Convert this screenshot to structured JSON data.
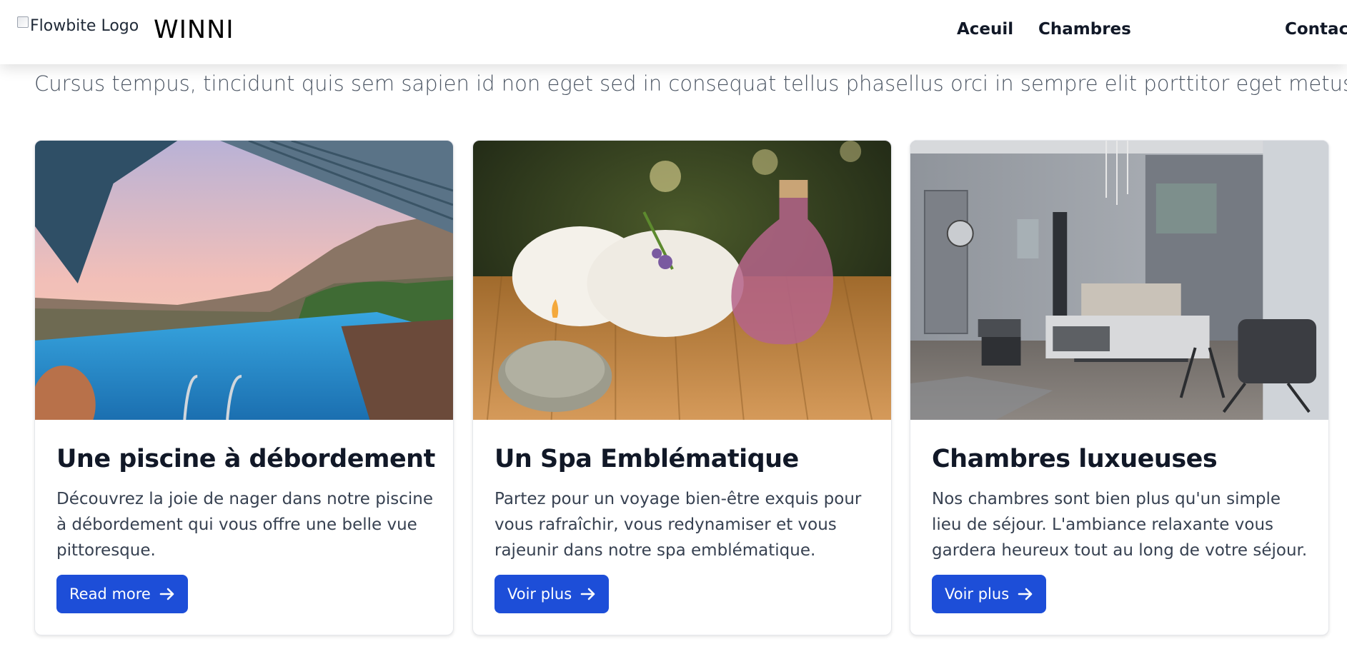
{
  "nav": {
    "logo_alt": "Flowbite Logo",
    "brand": "WINNI",
    "links": [
      "Aceuil",
      "Chambres",
      "Contact"
    ]
  },
  "hero": {
    "subtitle": "Cursus tempus, tincidunt quis sem sapien id non eget sed in consequat tellus phasellus orci in sempre elit porttitor eget metus."
  },
  "cards": [
    {
      "title": "Une piscine à débordement",
      "text": "Découvrez la joie de nager dans notre piscine à débordement qui vous offre une belle vue pittoresque.",
      "button": "Read more",
      "image": "infinity-pool-photo"
    },
    {
      "title": "Un Spa Emblématique",
      "text": "Partez pour un voyage bien-être exquis pour vous rafraîchir, vous redynamiser et vous rajeunir dans notre spa emblématique.",
      "button": "Voir plus",
      "image": "spa-towels-photo"
    },
    {
      "title": "Chambres luxueuses",
      "text": "Nos chambres sont bien plus qu'un simple lieu de séjour. L'ambiance relaxante vous gardera heureux tout au long de votre séjour.",
      "button": "Voir plus",
      "image": "luxury-bedroom-photo"
    }
  ],
  "colors": {
    "primary_button": "#1d4ed8",
    "heading": "#111827",
    "body_text": "#374151"
  },
  "icons": {
    "button_arrow": "arrow-right-icon"
  }
}
